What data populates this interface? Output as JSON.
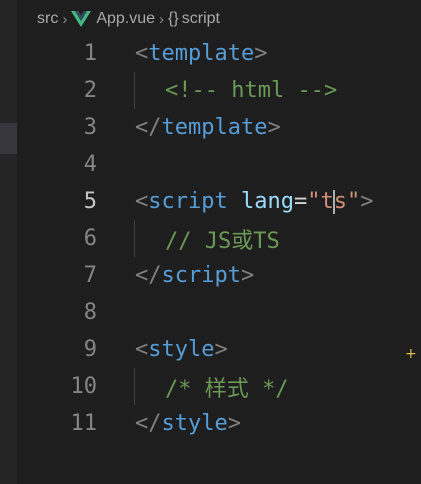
{
  "breadcrumb": {
    "folder": "src",
    "file": "App.vue",
    "symbol": "script",
    "symbol_icon": "{}"
  },
  "editor": {
    "active_line": "5",
    "lines": [
      {
        "num": "1"
      },
      {
        "num": "2"
      },
      {
        "num": "3"
      },
      {
        "num": "4"
      },
      {
        "num": "5"
      },
      {
        "num": "6"
      },
      {
        "num": "7"
      },
      {
        "num": "8"
      },
      {
        "num": "9"
      },
      {
        "num": "10"
      },
      {
        "num": "11"
      }
    ],
    "tokens": {
      "open_bracket": "<",
      "close_bracket": ">",
      "end_open": "</",
      "template": "template",
      "html_comment": "<!-- html -->",
      "script": "script",
      "lang_attr": "lang",
      "equals": "=",
      "quote": "\"",
      "lang_val_before_cursor": "t",
      "lang_val_after_cursor": "s",
      "js_comment": "// JS或TS",
      "style": "style",
      "css_comment": "/* 样式 */"
    }
  },
  "overlay": {
    "plus_glyph": "+"
  },
  "colors": {
    "background": "#1e1e1e",
    "tag": "#569cd6",
    "attr": "#9cdcfe",
    "string": "#ce9178",
    "comment": "#6a9955",
    "vue_green": "#41b883"
  }
}
